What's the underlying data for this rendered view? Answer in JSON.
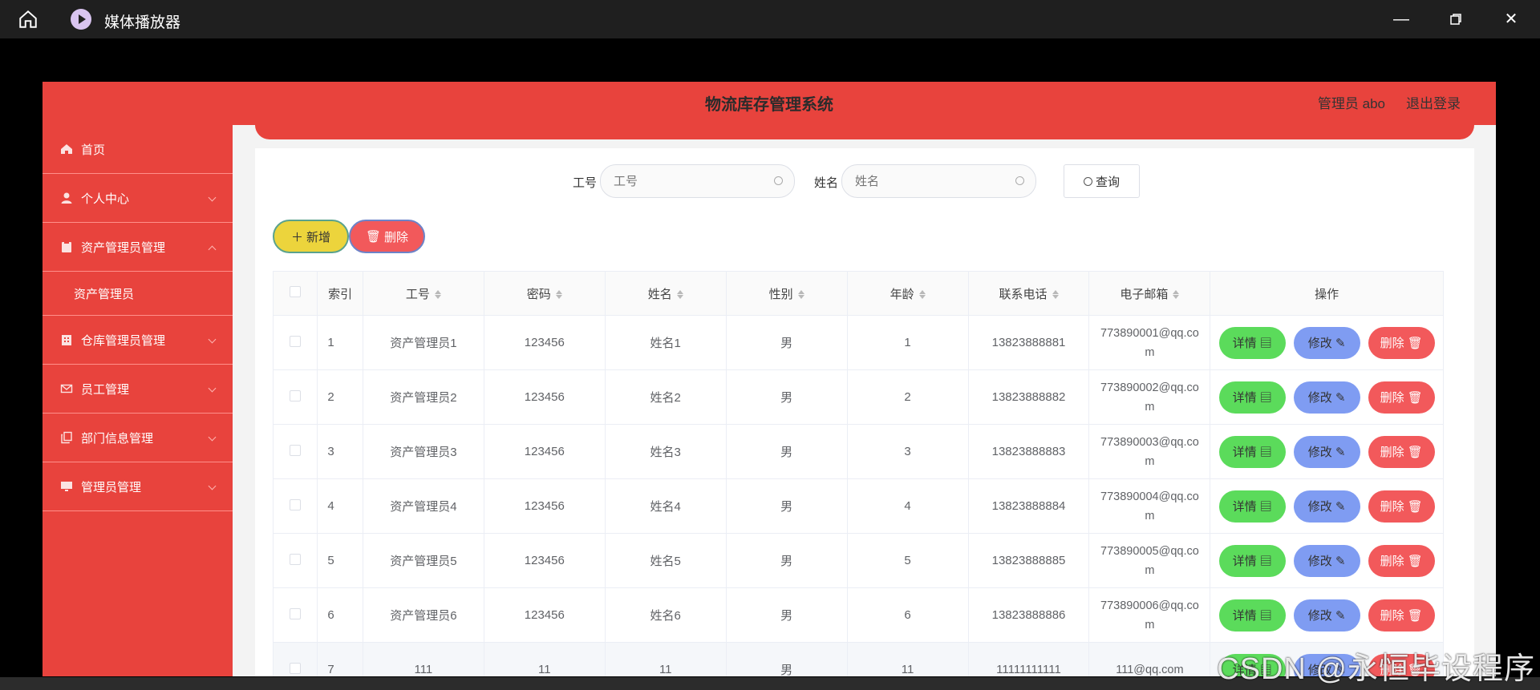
{
  "player": {
    "title": "媒体播放器",
    "home_icon": "home-icon",
    "app_icon": "media-player-icon"
  },
  "header": {
    "title": "物流库存管理系统",
    "user": "管理员 abo",
    "logout": "退出登录",
    "accent": "#e8433d"
  },
  "sidebar": {
    "items": [
      {
        "label": "首页",
        "icon": "home-icon"
      },
      {
        "label": "个人中心",
        "icon": "user-icon"
      },
      {
        "label": "资产管理员管理",
        "icon": "clipboard-icon",
        "expanded": true,
        "children": [
          "资产管理员"
        ]
      },
      {
        "label": "仓库管理员管理",
        "icon": "building-icon"
      },
      {
        "label": "员工管理",
        "icon": "mail-icon"
      },
      {
        "label": "部门信息管理",
        "icon": "copy-icon"
      },
      {
        "label": "管理员管理",
        "icon": "monitor-icon"
      }
    ]
  },
  "search": {
    "emp_no_label": "工号",
    "emp_no_placeholder": "工号",
    "name_label": "姓名",
    "name_placeholder": "姓名",
    "query_button": "查询"
  },
  "actions": {
    "add": "新增",
    "delete": "删除"
  },
  "table": {
    "columns": [
      "索引",
      "工号",
      "密码",
      "姓名",
      "性别",
      "年龄",
      "联系电话",
      "电子邮箱",
      "操作"
    ],
    "row_buttons": {
      "detail": "详情",
      "edit": "修改",
      "delete": "删除"
    },
    "rows": [
      {
        "index": "1",
        "emp_no": "资产管理员1",
        "password": "123456",
        "name": "姓名1",
        "gender": "男",
        "age": "1",
        "phone": "13823888881",
        "email": "773890001@qq.com"
      },
      {
        "index": "2",
        "emp_no": "资产管理员2",
        "password": "123456",
        "name": "姓名2",
        "gender": "男",
        "age": "2",
        "phone": "13823888882",
        "email": "773890002@qq.com"
      },
      {
        "index": "3",
        "emp_no": "资产管理员3",
        "password": "123456",
        "name": "姓名3",
        "gender": "男",
        "age": "3",
        "phone": "13823888883",
        "email": "773890003@qq.com"
      },
      {
        "index": "4",
        "emp_no": "资产管理员4",
        "password": "123456",
        "name": "姓名4",
        "gender": "男",
        "age": "4",
        "phone": "13823888884",
        "email": "773890004@qq.com"
      },
      {
        "index": "5",
        "emp_no": "资产管理员5",
        "password": "123456",
        "name": "姓名5",
        "gender": "男",
        "age": "5",
        "phone": "13823888885",
        "email": "773890005@qq.com"
      },
      {
        "index": "6",
        "emp_no": "资产管理员6",
        "password": "123456",
        "name": "姓名6",
        "gender": "男",
        "age": "6",
        "phone": "13823888886",
        "email": "773890006@qq.com"
      },
      {
        "index": "7",
        "emp_no": "111",
        "password": "11",
        "name": "11",
        "gender": "男",
        "age": "11",
        "phone": "11111111111",
        "email": "111@qq.com"
      }
    ]
  },
  "watermark": "CSDN @永恒毕设程序"
}
